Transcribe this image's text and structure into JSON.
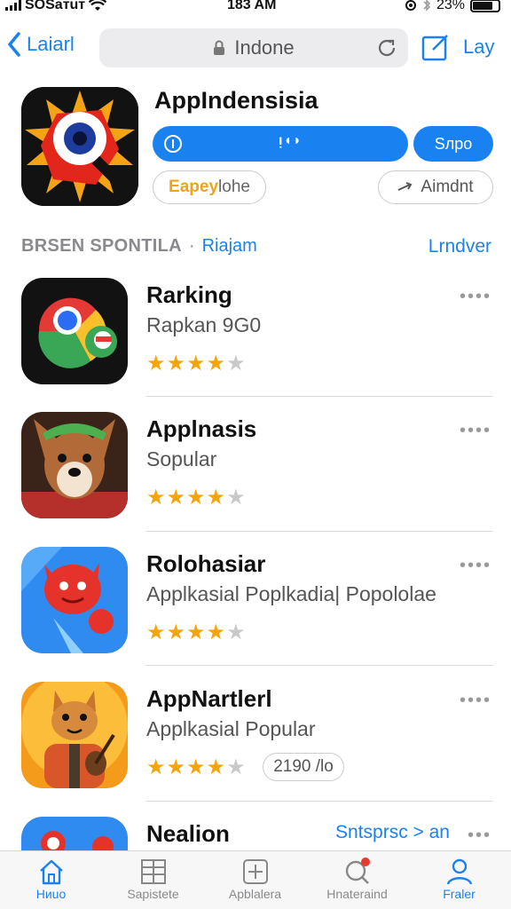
{
  "status": {
    "carrier": "SOSaтuт",
    "time": "183 AM",
    "battery": "23%"
  },
  "nav": {
    "back_label": "Laiarl",
    "url": "Indone",
    "right_label": "Lay"
  },
  "app": {
    "title": "AppIndensisia",
    "progress_text": "ᴉ◖◗",
    "open_label": "Sлро",
    "chip_left_accent": "Eapey",
    "chip_left_rest": "lohe",
    "chip_right_label": "Aimdnt"
  },
  "section": {
    "title": "BRSEN SPONTILA",
    "sub": "Riajam",
    "link": "Lrndver"
  },
  "list": [
    {
      "name": "Rarking",
      "desc": "Rapkan 9G0",
      "rating": 4
    },
    {
      "name": "Applnasis",
      "desc": "Sopular",
      "rating": 4
    },
    {
      "name": "Rolohasiar",
      "desc": "Applkasial Poplkadia| Popololae",
      "rating": 4
    },
    {
      "name": "AppNartlerl",
      "desc": "Applkasial Popular",
      "rating": 4,
      "count": "2190 /lo"
    },
    {
      "name": "Nealion",
      "link": "Sntsprsc > an"
    }
  ],
  "tabs": [
    {
      "label": "Hиuo",
      "icon": "home-icon",
      "active": true
    },
    {
      "label": "Sapistete",
      "icon": "grid-icon"
    },
    {
      "label": "Apblalera",
      "icon": "apps-icon"
    },
    {
      "label": "Hnateraind",
      "icon": "search-icon"
    },
    {
      "label": "Fraler",
      "icon": "person-icon",
      "active": true
    }
  ],
  "colors": {
    "accent": "#1a82f0",
    "star": "#f5a50c",
    "badge": "#e83a2e"
  }
}
